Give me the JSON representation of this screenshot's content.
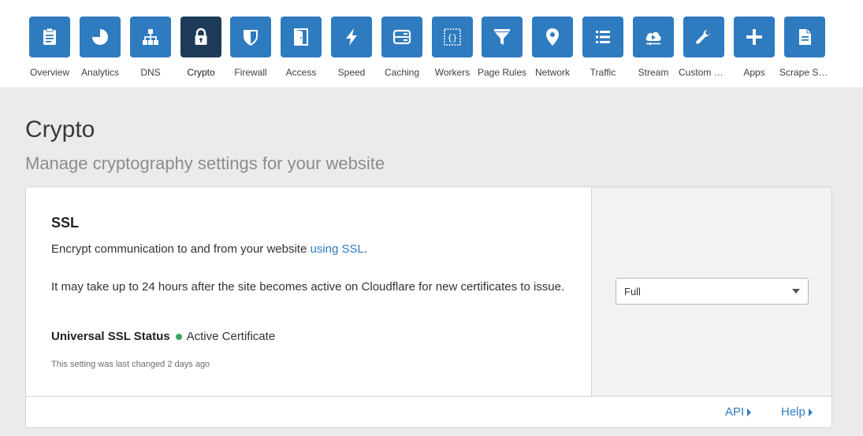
{
  "nav": {
    "items": [
      {
        "label": "Overview",
        "icon": "clipboard-icon"
      },
      {
        "label": "Analytics",
        "icon": "pie-chart-icon"
      },
      {
        "label": "DNS",
        "icon": "network-tree-icon"
      },
      {
        "label": "Crypto",
        "icon": "lock-icon",
        "active": true
      },
      {
        "label": "Firewall",
        "icon": "shield-icon"
      },
      {
        "label": "Access",
        "icon": "door-icon"
      },
      {
        "label": "Speed",
        "icon": "lightning-icon"
      },
      {
        "label": "Caching",
        "icon": "server-icon"
      },
      {
        "label": "Workers",
        "icon": "code-braces-icon"
      },
      {
        "label": "Page Rules",
        "icon": "filter-icon"
      },
      {
        "label": "Network",
        "icon": "location-pin-icon"
      },
      {
        "label": "Traffic",
        "icon": "list-icon"
      },
      {
        "label": "Stream",
        "icon": "cloud-play-icon"
      },
      {
        "label": "Custom Pa...",
        "icon": "wrench-icon"
      },
      {
        "label": "Apps",
        "icon": "plus-icon"
      },
      {
        "label": "Scrape Shi...",
        "icon": "document-icon"
      }
    ]
  },
  "page": {
    "title": "Crypto",
    "subtitle": "Manage cryptography settings for your website"
  },
  "ssl_card": {
    "title": "SSL",
    "description_prefix": "Encrypt communication to and from your website ",
    "description_link": "using SSL",
    "description_suffix": ".",
    "note": "It may take up to 24 hours after the site becomes active on Cloudflare for new certificates to issue.",
    "status_label": "Universal SSL Status",
    "status_value": "Active Certificate",
    "last_changed": "This setting was last changed 2 days ago",
    "select_value": "Full"
  },
  "footer": {
    "api_label": "API",
    "help_label": "Help"
  },
  "colors": {
    "accent": "#2f7bbf",
    "active_tile": "#1d3a58",
    "status_ok": "#3fa367"
  }
}
